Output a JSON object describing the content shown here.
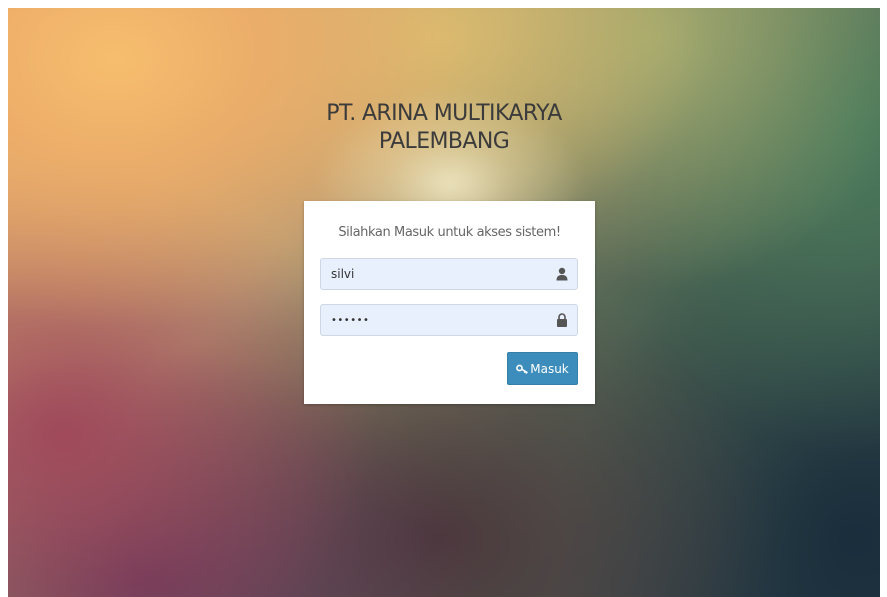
{
  "header": {
    "title_line1": "PT. ARINA MULTIKARYA",
    "title_line2": "PALEMBANG"
  },
  "login": {
    "message": "Silahkan Masuk untuk akses sistem!",
    "username_value": "silvi",
    "username_icon": "user-icon",
    "password_value": "••••••",
    "password_icon": "lock-icon",
    "submit_label": "Masuk",
    "submit_icon": "key-icon"
  },
  "colors": {
    "button": "#3c8dbc",
    "field_bg": "#e8f0fe",
    "panel_bg": "#ffffff"
  }
}
